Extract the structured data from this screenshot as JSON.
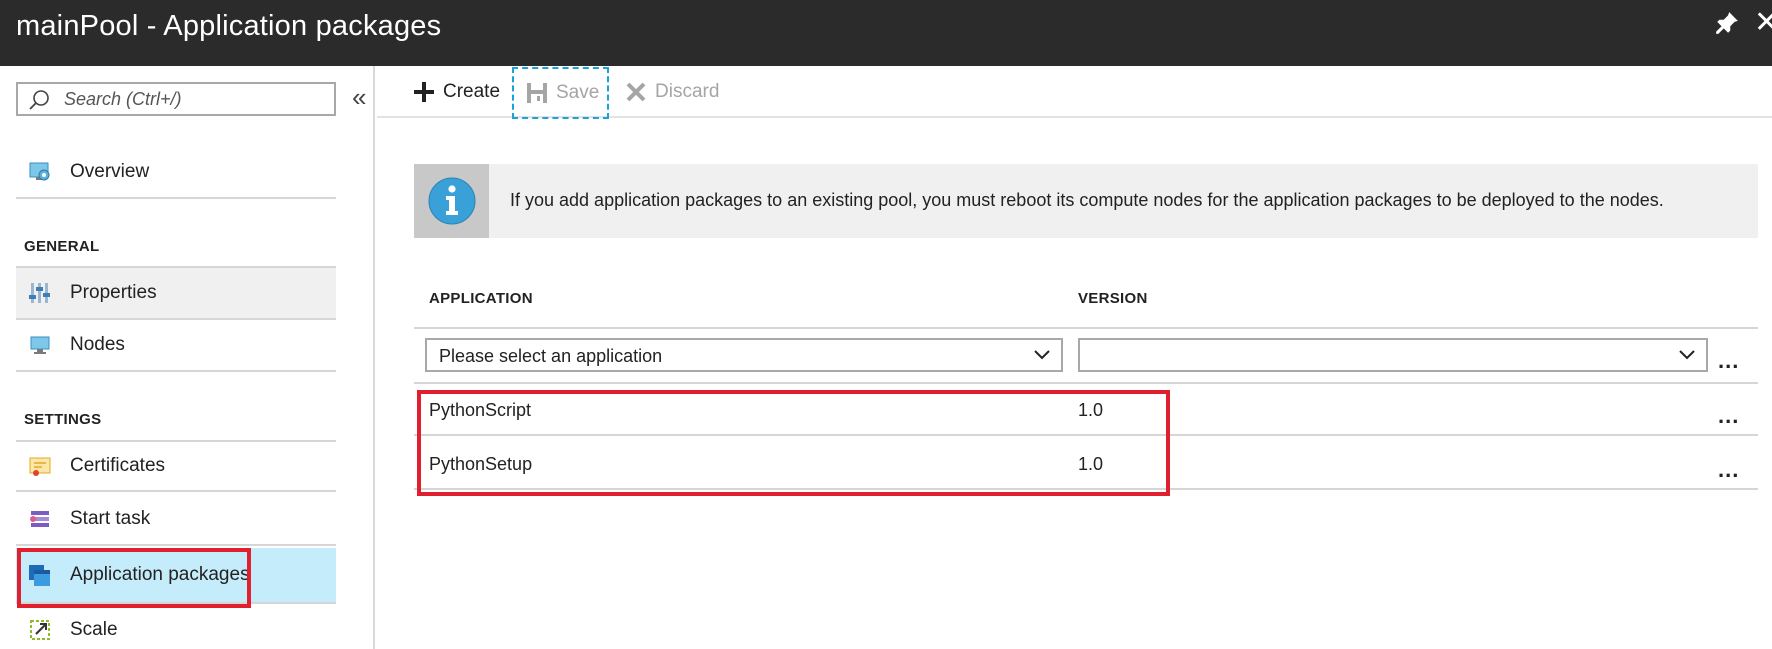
{
  "window": {
    "title": "mainPool - Application packages",
    "pin_icon": "pin-icon",
    "close_label": "✕"
  },
  "sidebar": {
    "search_placeholder": "Search (Ctrl+/)",
    "collapse_label": "«",
    "top_items": [
      {
        "label": "Overview",
        "icon": "overview-icon"
      }
    ],
    "sections": [
      {
        "title": "GENERAL",
        "items": [
          {
            "label": "Properties",
            "icon": "properties-icon"
          },
          {
            "label": "Nodes",
            "icon": "nodes-icon"
          }
        ]
      },
      {
        "title": "SETTINGS",
        "items": [
          {
            "label": "Certificates",
            "icon": "certificate-icon"
          },
          {
            "label": "Start task",
            "icon": "start-task-icon"
          },
          {
            "label": "Application packages",
            "icon": "application-packages-icon",
            "active": true
          },
          {
            "label": "Scale",
            "icon": "scale-icon"
          }
        ]
      }
    ]
  },
  "toolbar": {
    "create_label": "Create",
    "save_label": "Save",
    "discard_label": "Discard"
  },
  "info_banner": {
    "text": "If you add application packages to an existing pool, you must reboot its compute nodes for the application packages to be deployed to the nodes.",
    "icon": "info-icon"
  },
  "table": {
    "headers": {
      "application": "APPLICATION",
      "version": "VERSION"
    },
    "application_select": {
      "value": "Please select an application"
    },
    "version_select": {
      "value": ""
    },
    "rows": [
      {
        "application": "PythonScript",
        "version": "1.0"
      },
      {
        "application": "PythonSetup",
        "version": "1.0"
      }
    ],
    "more_label": "..."
  },
  "colors": {
    "titlebar": "#2b2b2b",
    "active_item": "#c4ecfa",
    "highlight": "#e0202e",
    "focus_dash": "#1aa3d6"
  }
}
